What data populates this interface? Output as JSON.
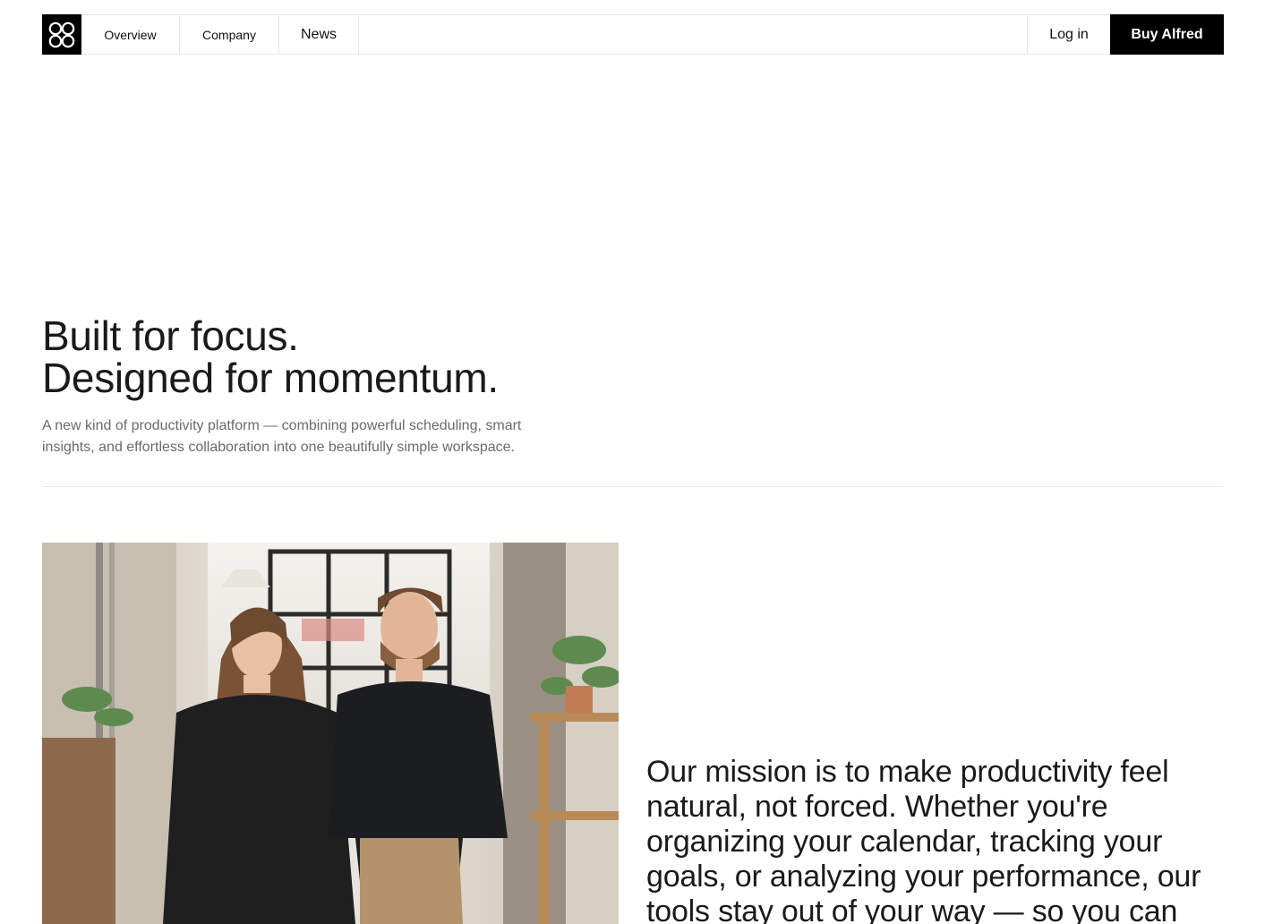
{
  "nav": {
    "logo_icon": "four-circles-logo-icon",
    "links": [
      {
        "label": "Overview"
      },
      {
        "label": "Company"
      },
      {
        "label": "News"
      }
    ],
    "login_label": "Log in",
    "buy_label": "Buy Alfred"
  },
  "hero": {
    "title_line1": "Built for focus.",
    "title_line2": "Designed for momentum.",
    "subtitle": "A new kind of productivity platform — combining powerful scheduling, smart insights, and effortless collaboration into one beautifully simple workspace."
  },
  "mission": {
    "text": "Our mission is to make productivity feel natural, not forced. Whether you're organizing your calendar, tracking your goals, or analyzing your performance, our tools stay out of your way — so you can"
  },
  "colors": {
    "text": "#111111",
    "muted": "#6b6b6b",
    "accent": "#000000",
    "border": "#e6e6e6",
    "background": "#ffffff"
  }
}
